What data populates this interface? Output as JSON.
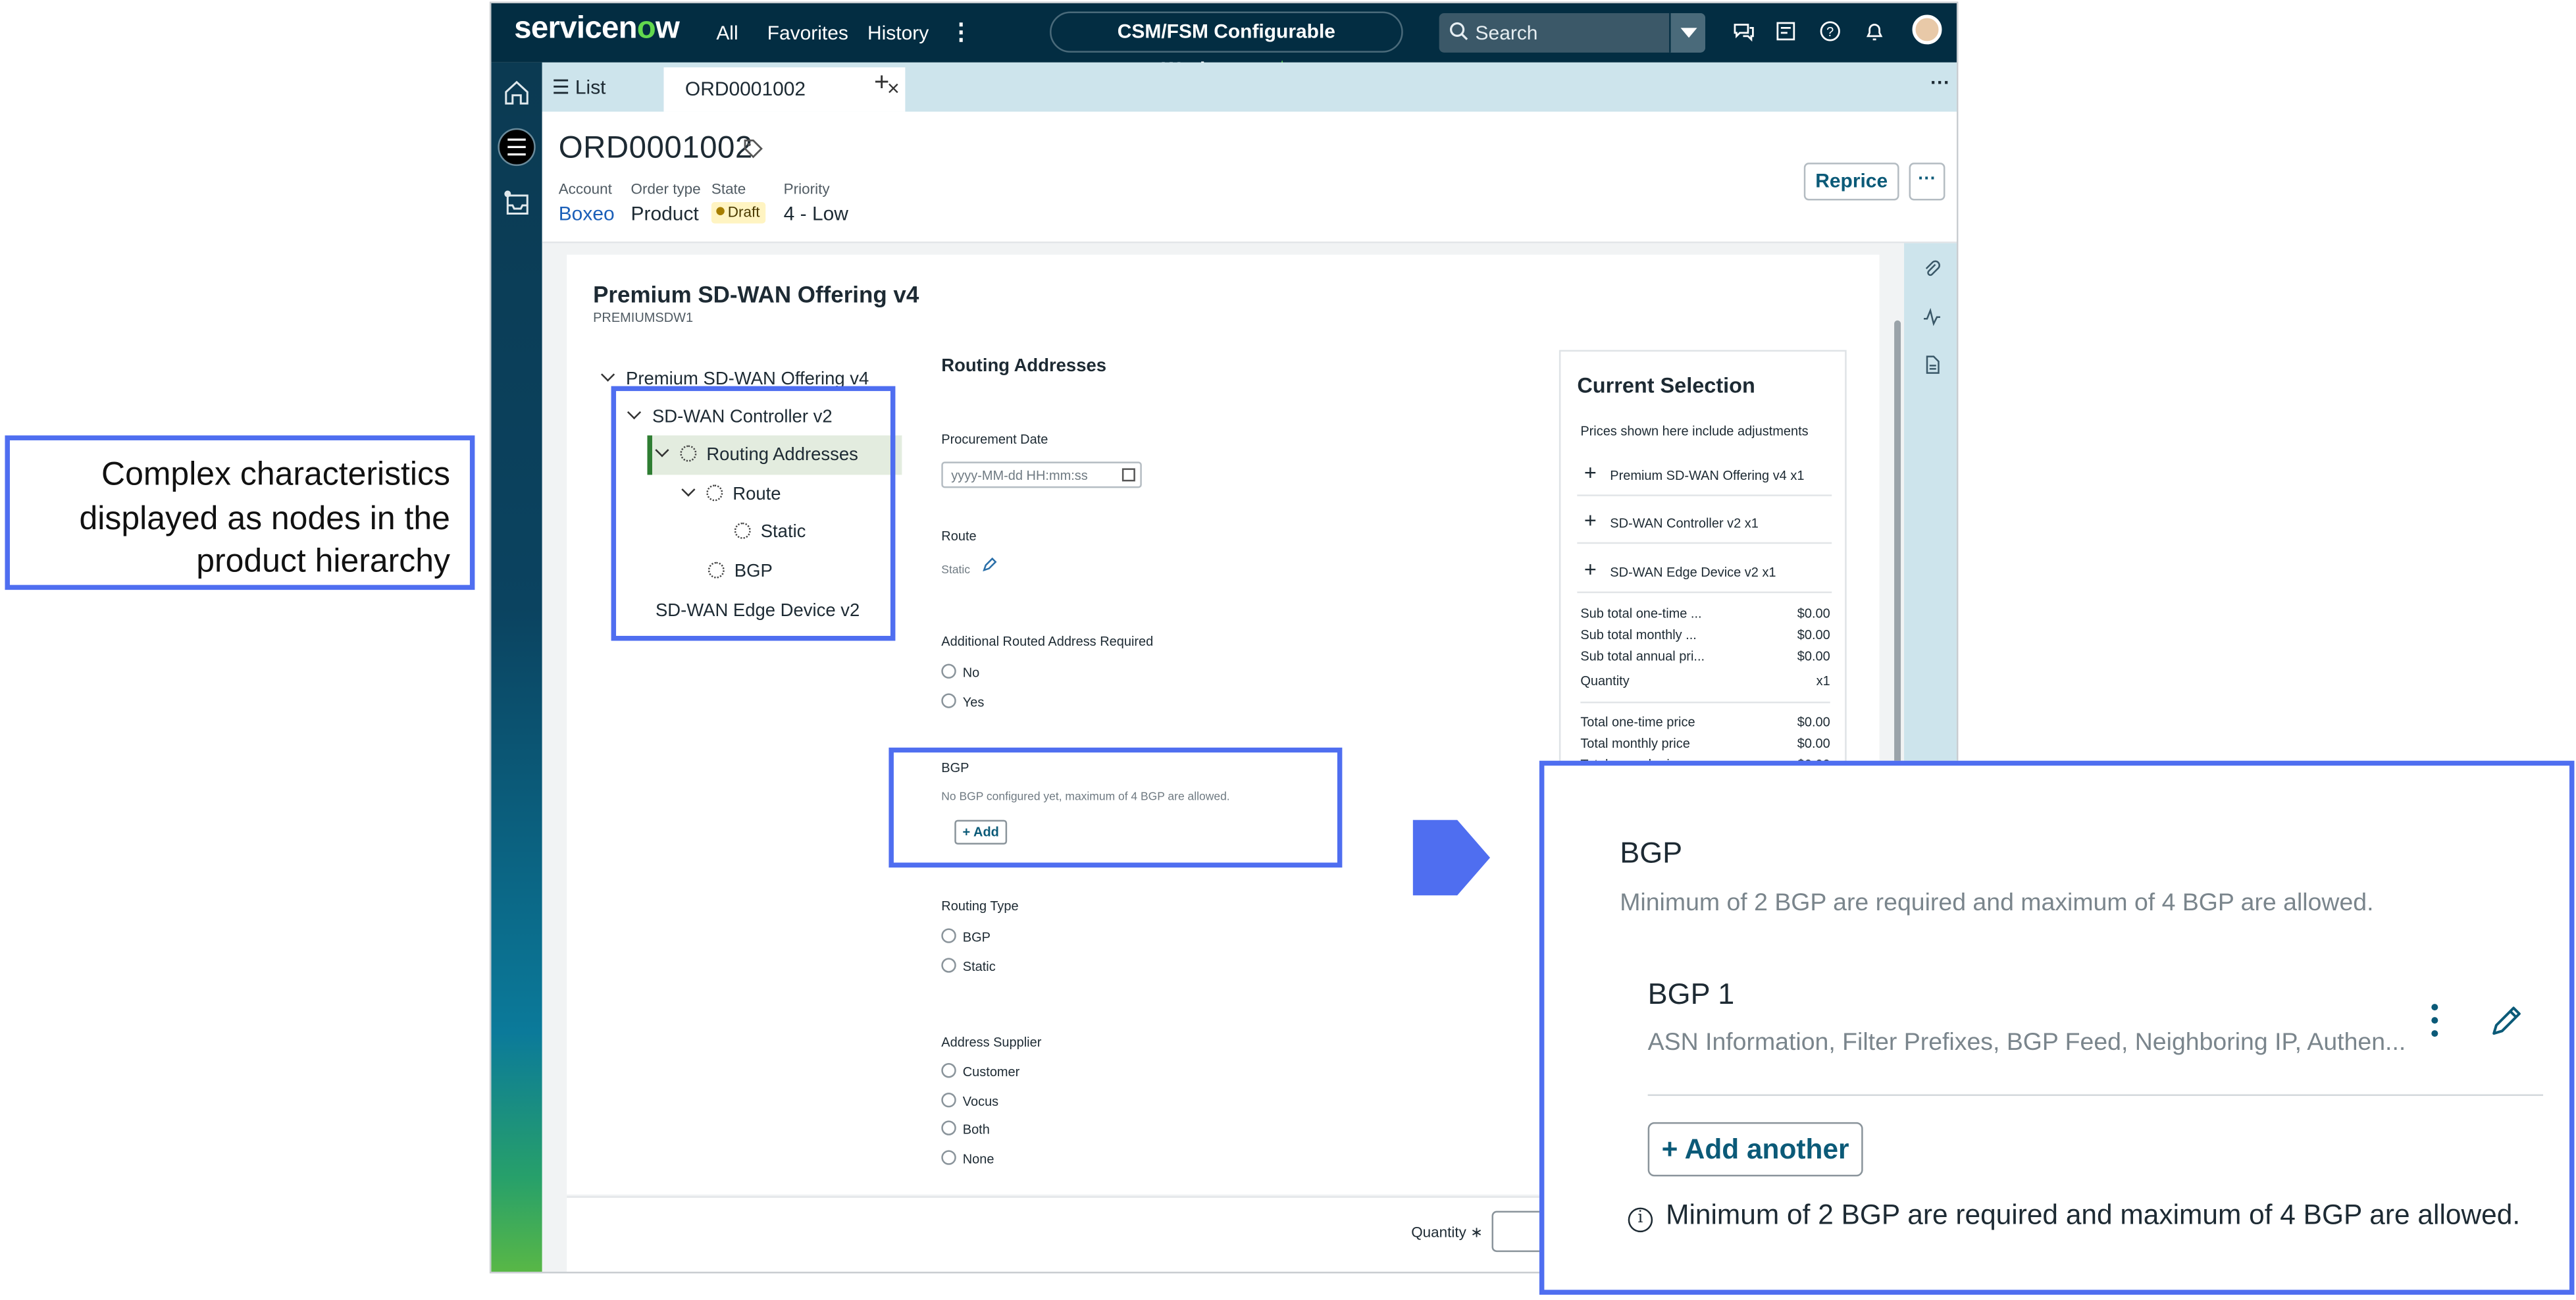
{
  "annotation": {
    "lines": [
      "Complex characteristics",
      "displayed as nodes in the",
      "product hierarchy"
    ]
  },
  "topbar": {
    "logo": "servicenow",
    "nav": [
      "All",
      "Favorites",
      "History"
    ],
    "workspace": "CSM/FSM Configurable Workspace",
    "search_placeholder": "Search"
  },
  "tabs": {
    "list_label": "List",
    "active_label": "ORD0001002"
  },
  "record": {
    "title": "ORD0001002",
    "fields": [
      {
        "label": "Account",
        "value": "Boxeo"
      },
      {
        "label": "Order type",
        "value": "Product"
      },
      {
        "label": "State",
        "value": "Draft"
      },
      {
        "label": "Priority",
        "value": "4 - Low"
      }
    ],
    "reprice_label": "Reprice"
  },
  "product": {
    "title": "Premium SD-WAN Offering v4",
    "code": "PREMIUMSDW1",
    "tree": [
      {
        "label": "Premium SD-WAN Offering v4",
        "level": 0,
        "chevron": true,
        "gear": false
      },
      {
        "label": "SD-WAN Controller v2",
        "level": 1,
        "chevron": true,
        "gear": false
      },
      {
        "label": "Routing Addresses",
        "level": 2,
        "chevron": true,
        "gear": true,
        "selected": true
      },
      {
        "label": "Route",
        "level": 3,
        "chevron": true,
        "gear": true
      },
      {
        "label": "Static",
        "level": 4,
        "chevron": false,
        "gear": true
      },
      {
        "label": "BGP",
        "level": 3,
        "chevron": false,
        "gear": true
      },
      {
        "label": "SD-WAN Edge Device v2",
        "level": 1,
        "chevron": false,
        "gear": false
      }
    ]
  },
  "form": {
    "section_title": "Routing Addresses",
    "procurement_label": "Procurement Date",
    "procurement_placeholder": "yyyy-MM-dd HH:mm:ss",
    "route_label": "Route",
    "route_value": "Static",
    "additional_label": "Additional Routed Address Required",
    "additional_options": [
      "No",
      "Yes"
    ],
    "bgp_label": "BGP",
    "bgp_desc": "No BGP configured yet, maximum of 4 BGP are allowed.",
    "bgp_add": "+ Add",
    "routing_type_label": "Routing Type",
    "routing_type_options": [
      "BGP",
      "Static"
    ],
    "supplier_label": "Address Supplier",
    "supplier_options": [
      "Customer",
      "Vocus",
      "Both",
      "None"
    ],
    "quantity_label": "Quantity"
  },
  "current_selection": {
    "title": "Current Selection",
    "note": "Prices shown here include adjustments",
    "items": [
      "Premium SD-WAN Offering v4 x1",
      "SD-WAN Controller v2 x1",
      "SD-WAN Edge Device v2 x1"
    ],
    "subtotals": [
      {
        "label": "Sub total one-time ...",
        "value": "$0.00"
      },
      {
        "label": "Sub total monthly ...",
        "value": "$0.00"
      },
      {
        "label": "Sub total annual pri...",
        "value": "$0.00"
      },
      {
        "label": "Quantity",
        "value": "x1"
      }
    ],
    "totals": [
      {
        "label": "Total one-time price",
        "value": "$0.00"
      },
      {
        "label": "Total monthly price",
        "value": "$0.00"
      },
      {
        "label": "Total annual price",
        "value": "$0.00"
      }
    ]
  },
  "zoom": {
    "title": "BGP",
    "desc": "Minimum of 2 BGP are required and maximum of 4 BGP are allowed.",
    "item_title": "BGP 1",
    "item_desc": "ASN Information, Filter Prefixes, BGP Feed, Neighboring IP, Authen...",
    "add_label": "+ Add another",
    "info": "Minimum of 2 BGP are required and maximum of 4 BGP are allowed."
  },
  "colors": {
    "highlight": "#4f6ef0",
    "topbar": "#032d42",
    "accent_green": "#62d84e",
    "link_blue": "#1b5fb8"
  }
}
